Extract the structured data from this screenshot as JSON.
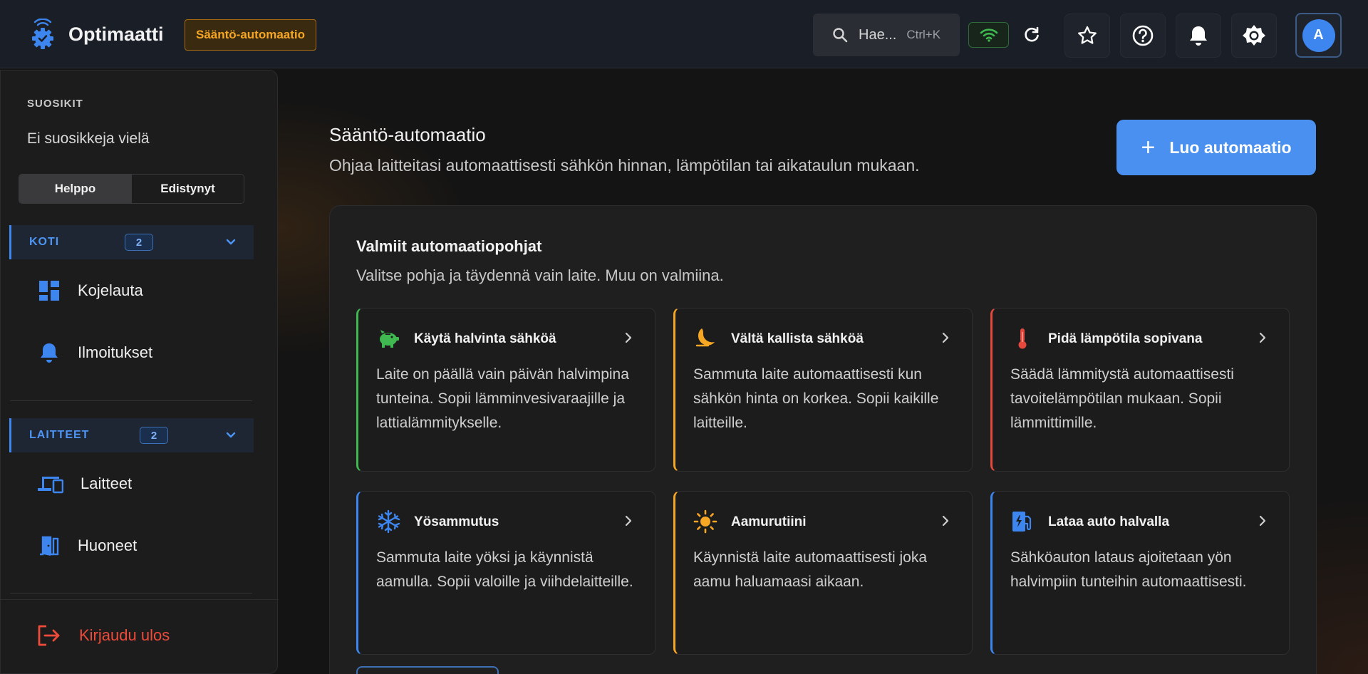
{
  "header": {
    "app_name": "Optimaatti",
    "page_badge": "Sääntö-automaatio",
    "search_placeholder": "Hae...",
    "search_shortcut": "Ctrl+K",
    "avatar_initial": "A"
  },
  "sidebar": {
    "favorites_title": "SUOSIKIT",
    "favorites_empty": "Ei suosikkeja vielä",
    "mode_easy": "Helppo",
    "mode_advanced": "Edistynyt",
    "groups": [
      {
        "name": "KOTI",
        "count": "2",
        "items": [
          {
            "label": "Kojelauta"
          },
          {
            "label": "Ilmoitukset"
          }
        ]
      },
      {
        "name": "LAITTEET",
        "count": "2",
        "items": [
          {
            "label": "Laitteet"
          },
          {
            "label": "Huoneet"
          }
        ]
      }
    ],
    "logout": "Kirjaudu ulos"
  },
  "main": {
    "title": "Sääntö-automaatio",
    "subtitle": "Ohjaa laitteitasi automaattisesti sähkön hinnan, lämpötilan tai aikataulun mukaan.",
    "create_button": "Luo automaatio",
    "templates_title": "Valmiit automaatiopohjat",
    "templates_subtitle": "Valitse pohja ja täydennä vain laite. Muu on valmiina.",
    "templates": [
      {
        "title": "Käytä halvinta sähköä",
        "icon": "piggy-bank-icon",
        "accent": "#3fb950",
        "desc": "Laite on päällä vain päivän halvimpina tunteina. Sopii lämminvesivaraajille ja lattialämmitykselle."
      },
      {
        "title": "Vältä kallista sähköä",
        "icon": "moon-icon",
        "accent": "#f5a623",
        "desc": "Sammuta laite automaattisesti kun sähkön hinta on korkea. Sopii kaikille laitteille."
      },
      {
        "title": "Pidä lämpötila sopivana",
        "icon": "thermometer-icon",
        "accent": "#e5483c",
        "desc": "Säädä lämmitystä automaattisesti tavoitelämpötilan mukaan. Sopii lämmittimille."
      },
      {
        "title": "Yösammutus",
        "icon": "snowflake-icon",
        "accent": "#3d86f0",
        "desc": "Sammuta laite yöksi ja käynnistä aamulla. Sopii valoille ja viihdelaitteille."
      },
      {
        "title": "Aamurutiini",
        "icon": "sun-icon",
        "accent": "#f5a623",
        "desc": "Käynnistä laite automaattisesti joka aamu haluamaasi aikaan."
      },
      {
        "title": "Lataa auto halvalla",
        "icon": "ev-charger-icon",
        "accent": "#3d86f0",
        "desc": "Sähköauton lataus ajoitetaan yön halvimpiin tunteihin automaattisesti."
      }
    ]
  },
  "colors": {
    "accent_blue": "#3d86f0",
    "accent_orange": "#f5a623",
    "danger": "#ef4b3a",
    "success": "#3fb950"
  }
}
